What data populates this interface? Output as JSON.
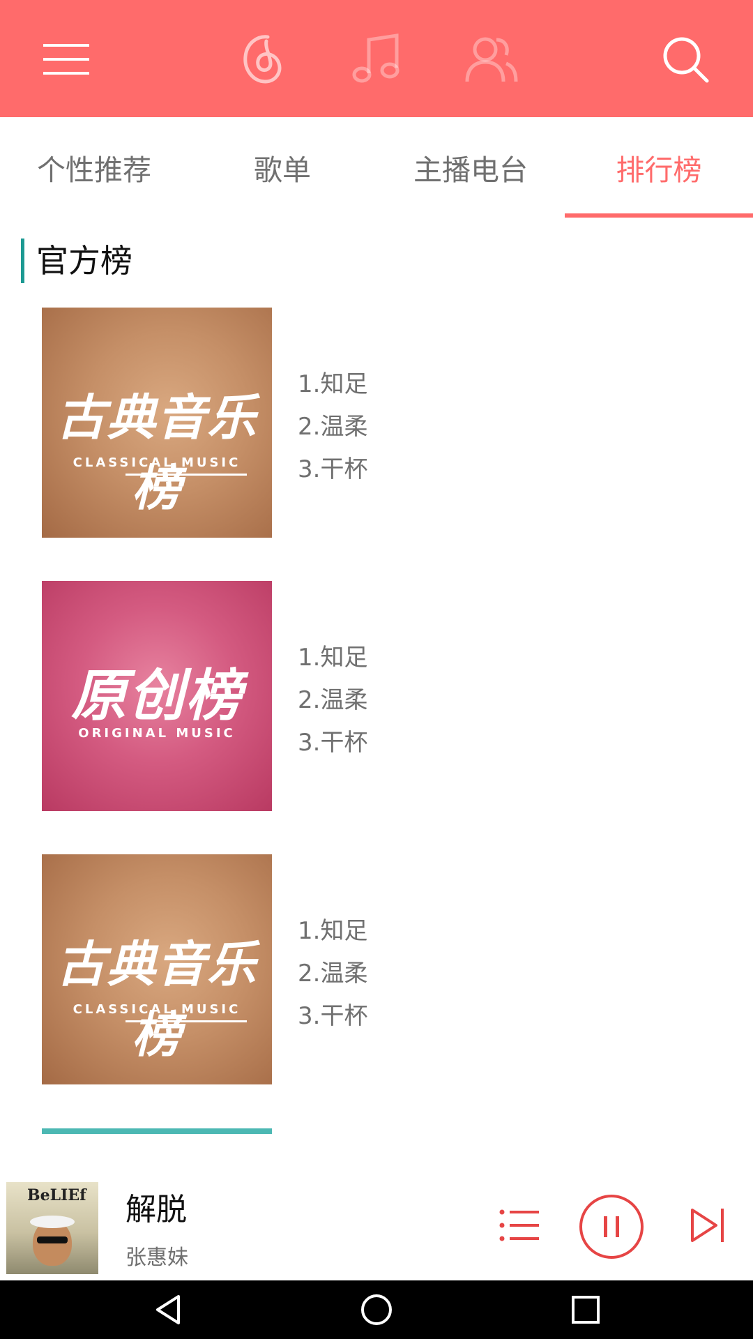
{
  "appbar": {
    "icons": [
      "menu-icon",
      "netease-logo-icon",
      "music-note-icon",
      "friends-icon",
      "search-icon"
    ],
    "background": "#ff6b6b"
  },
  "tabs": [
    {
      "label": "个性推荐",
      "active": false
    },
    {
      "label": "歌单",
      "active": false
    },
    {
      "label": "主播电台",
      "active": false
    },
    {
      "label": "排行榜",
      "active": true
    }
  ],
  "section": {
    "title": "官方榜"
  },
  "charts": [
    {
      "cover_text": "古典音乐榜",
      "cover_sub": "CLASSICAL MUSIC",
      "tracks": [
        "1.知足",
        "2.温柔",
        "3.干杯"
      ]
    },
    {
      "cover_text": "原创榜",
      "cover_sub": "ORIGINAL MUSIC",
      "tracks": [
        "1.知足",
        "2.温柔",
        "3.干杯"
      ]
    },
    {
      "cover_text": "古典音乐榜",
      "cover_sub": "CLASSICAL MUSIC",
      "tracks": [
        "1.知足",
        "2.温柔",
        "3.干杯"
      ]
    }
  ],
  "player": {
    "album_text": "BeLIEf",
    "title": "解脱",
    "artist": "张惠妹",
    "icons": [
      "playlist-icon",
      "pause-icon",
      "skip-next-icon"
    ]
  },
  "navbar": {
    "icons": [
      "back-icon",
      "home-icon",
      "recents-icon"
    ]
  },
  "colors": {
    "accent": "#ff6b6b",
    "section_marker": "#1d9a93",
    "secondary_text": "#707070"
  }
}
